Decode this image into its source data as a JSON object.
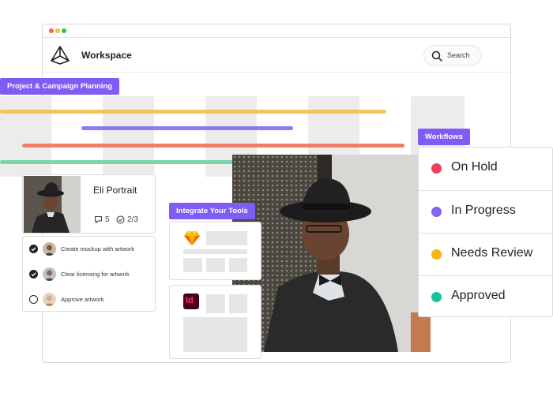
{
  "window": {
    "traffic_lights": [
      "#ff5f57",
      "#febc2e",
      "#28c840"
    ],
    "app_title": "Workspace",
    "search_label": "Search"
  },
  "labels": {
    "planning": "Project & Campaign Planning",
    "workflows": "Workflows",
    "integrate": "Integrate Your Tools"
  },
  "gantt": {
    "bars": [
      {
        "color": "#f3c45c"
      },
      {
        "color": "#8d7bf4"
      },
      {
        "color": "#f37d67"
      },
      {
        "color": "#7dd5ab"
      }
    ]
  },
  "portrait_card": {
    "name": "Eli Portrait",
    "comments": "5",
    "tasks_done": "2/3"
  },
  "tasks": [
    {
      "label": "Create mockup with artwork",
      "done": true
    },
    {
      "label": "Clear licensing for artwork",
      "done": true
    },
    {
      "label": "Approve artwork",
      "done": false
    }
  ],
  "integrations": [
    {
      "icon": "sketch-icon"
    },
    {
      "icon": "indesign-icon",
      "glyph": "Id"
    }
  ],
  "workflow_statuses": [
    {
      "label": "On Hold",
      "color": "#f0405a"
    },
    {
      "label": "In Progress",
      "color": "#8566f3"
    },
    {
      "label": "Needs Review",
      "color": "#f5b50f"
    },
    {
      "label": "Approved",
      "color": "#16c49a"
    }
  ]
}
